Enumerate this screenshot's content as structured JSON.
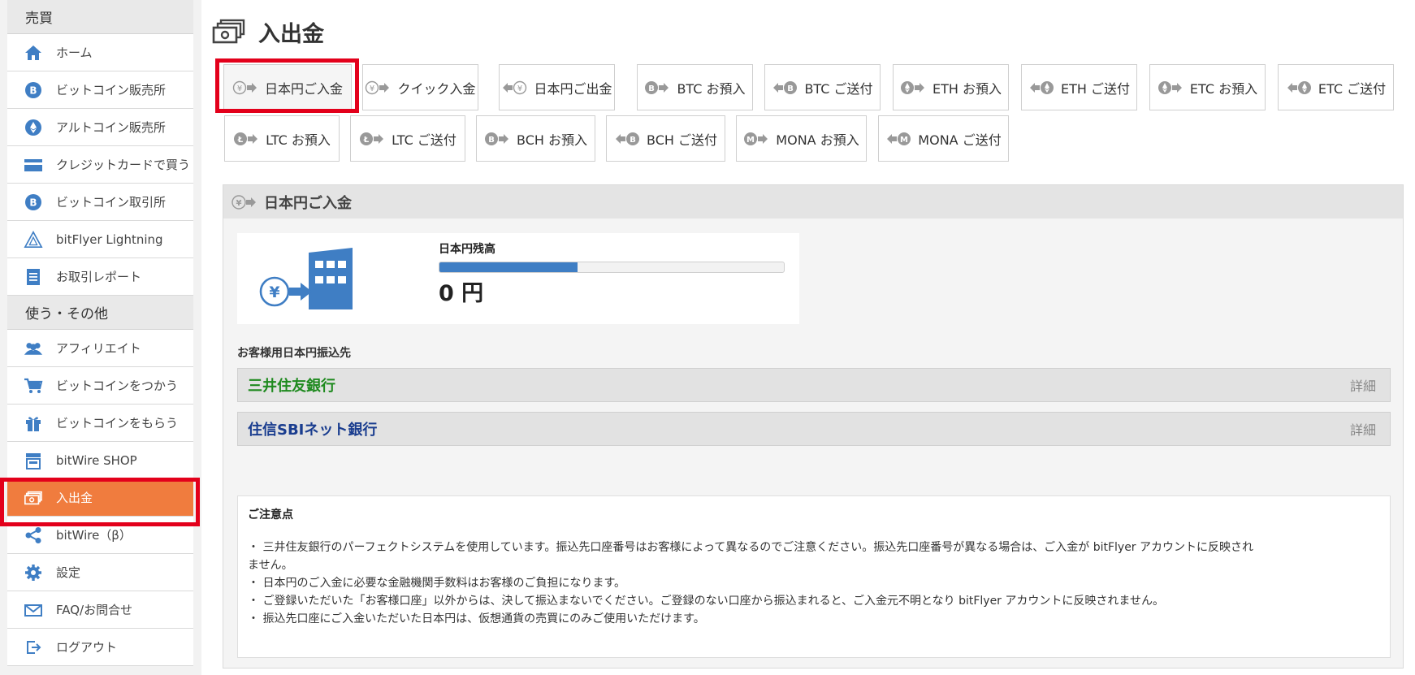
{
  "sidebar": {
    "section_trade": "売買",
    "section_other": "使う・その他",
    "items": [
      {
        "label": "ホーム",
        "icon": "home-icon"
      },
      {
        "label": "ビットコイン販売所",
        "icon": "bitcoin-icon"
      },
      {
        "label": "アルトコイン販売所",
        "icon": "ethereum-icon"
      },
      {
        "label": "クレジットカードで買う",
        "icon": "credit-card-icon"
      },
      {
        "label": "ビットコイン取引所",
        "icon": "bitcoin-icon"
      },
      {
        "label": "bitFlyer Lightning",
        "icon": "lightning-triangle-icon"
      },
      {
        "label": "お取引レポート",
        "icon": "report-icon"
      },
      {
        "label": "アフィリエイト",
        "icon": "users-icon"
      },
      {
        "label": "ビットコインをつかう",
        "icon": "cart-icon"
      },
      {
        "label": "ビットコインをもらう",
        "icon": "gift-icon"
      },
      {
        "label": "bitWire SHOP",
        "icon": "shop-icon"
      },
      {
        "label": "入出金",
        "icon": "cash-icon"
      },
      {
        "label": "bitWire（β）",
        "icon": "share-icon"
      },
      {
        "label": "設定",
        "icon": "gear-icon"
      },
      {
        "label": "FAQ/お問合せ",
        "icon": "mail-icon"
      },
      {
        "label": "ログアウト",
        "icon": "logout-icon"
      }
    ]
  },
  "page": {
    "title": "入出金"
  },
  "tabs": {
    "row1": [
      "日本円ご入金",
      "クイック入金",
      "日本円ご出金",
      "BTC お預入",
      "BTC ご送付",
      "ETH お預入",
      "ETH ご送付",
      "ETC お預入",
      "ETC ご送付"
    ],
    "row2": [
      "LTC お預入",
      "LTC ご送付",
      "BCH お預入",
      "BCH ご送付",
      "MONA お預入",
      "MONA ご送付"
    ],
    "selected": "日本円ご入金"
  },
  "panel": {
    "heading": "日本円ご入金",
    "balance_label": "日本円残高",
    "balance_amount": "0 円",
    "balance_progress": 0.4,
    "bank_section_label": "お客様用日本円振込先",
    "banks": [
      {
        "name": "三井住友銀行",
        "detail": "詳細",
        "color": "#1f8a1f"
      },
      {
        "name": "住信SBIネット銀行",
        "detail": "詳細",
        "color": "#1a3d8f"
      }
    ],
    "notes_title": "ご注意点",
    "notes": [
      "・ 三井住友銀行のパーフェクトシステムを使用しています。振込先口座番号はお客様によって異なるのでご注意ください。振込先口座番号が異なる場合は、ご入金が bitFlyer アカウントに反映され",
      "ません。",
      "・ 日本円のご入金に必要な金融機関手数料はお客様のご負担になります。",
      "・ ご登録いただいた「お客様口座」以外からは、決して振込まないでください。ご登録のない口座から振込まれると、ご入金元不明となり bitFlyer アカウントに反映されません。",
      "・ 振込先口座にご入金いただいた日本円は、仮想通貨の売買にのみご使用いただけます。"
    ]
  },
  "colors": {
    "accent": "#f07c3e",
    "highlight": "#e3001b",
    "icon_blue": "#3f7ec4",
    "progress": "#3f7ec4"
  }
}
